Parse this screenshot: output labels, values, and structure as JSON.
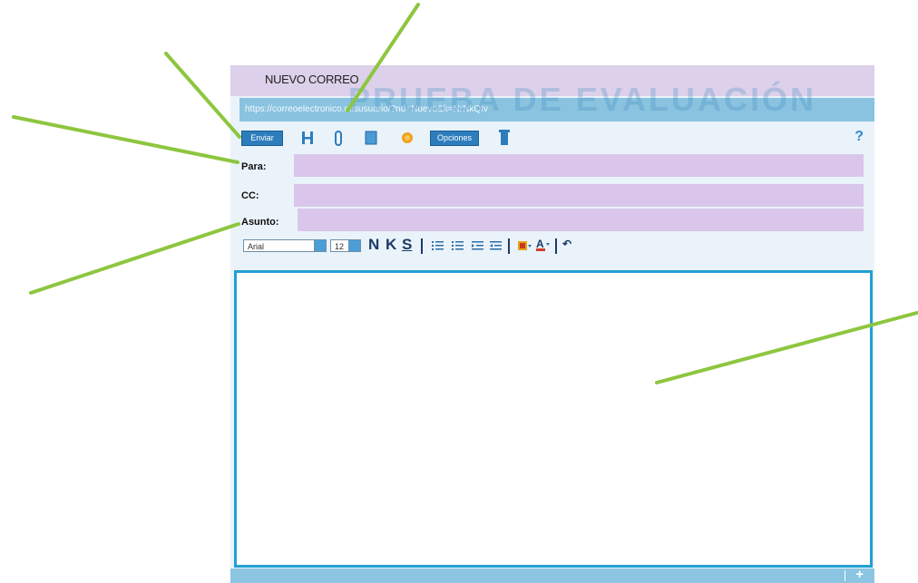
{
  "window": {
    "title": "NUEVO CORREO"
  },
  "address_bar": {
    "url": "https://correoelectronico.misusuario/?nd=Nuevo&k=NrNkQfv"
  },
  "watermark": {
    "text": "PRUEBA DE EVALUACIÓN"
  },
  "toolbar": {
    "send_label": "Enviar",
    "options_label": "Opciones",
    "help_label": "?",
    "icons": [
      "save-icon",
      "attach-icon",
      "address-book-icon",
      "emoticon-icon",
      "trash-icon"
    ]
  },
  "fields": {
    "to_label": "Para:",
    "cc_label": "CC:",
    "subject_label": "Asunto:"
  },
  "format_bar": {
    "font": "Arial",
    "size": "12",
    "bold": "N",
    "italic": "K",
    "underline": "S",
    "undo_label": "↶"
  },
  "status_bar": {
    "expand_label": "+"
  },
  "colors": {
    "title_bg": "#ddd0ea",
    "url_bg": "#89c3e0",
    "field_bg": "#d9c6ea",
    "accent": "#23a0d2",
    "annotation_arrow": "#8dc63f"
  }
}
